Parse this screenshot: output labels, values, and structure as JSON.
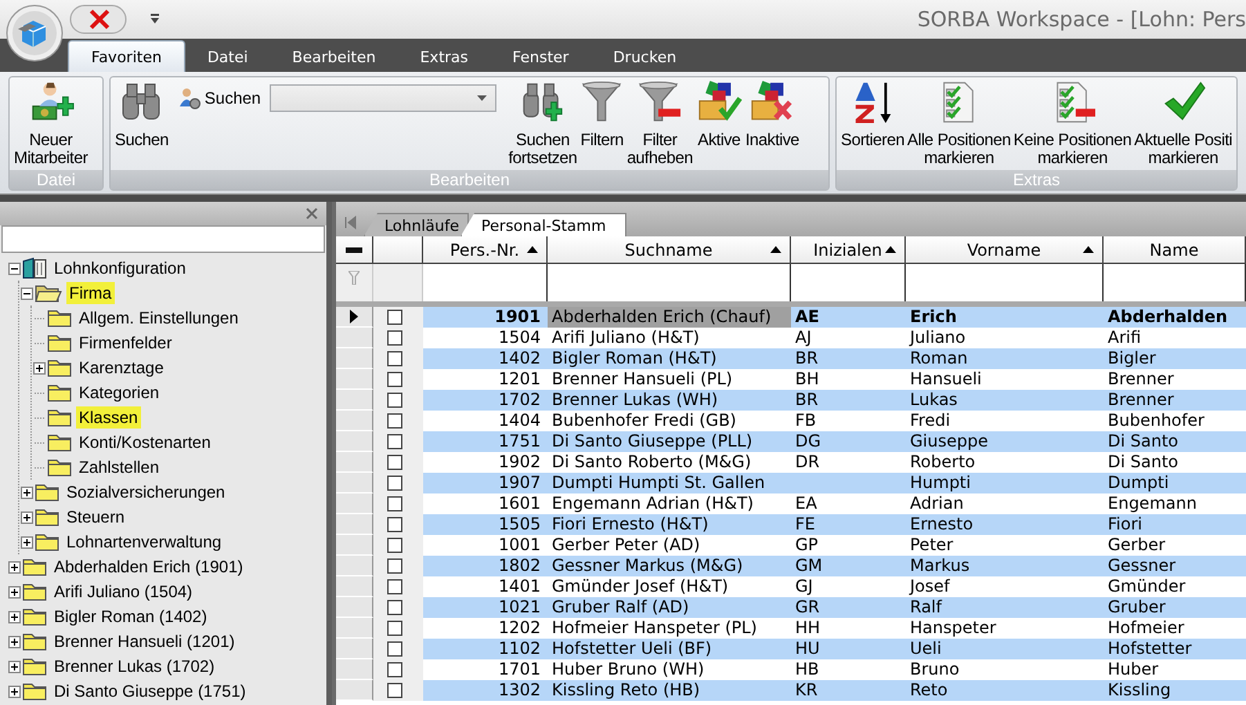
{
  "window": {
    "title": "SORBA Workspace - [Lohn: Pers"
  },
  "ribbon_tabs": [
    {
      "label": "Favoriten",
      "selected": true
    },
    {
      "label": "Datei",
      "selected": false
    },
    {
      "label": "Bearbeiten",
      "selected": false
    },
    {
      "label": "Extras",
      "selected": false
    },
    {
      "label": "Fenster",
      "selected": false
    },
    {
      "label": "Drucken",
      "selected": false
    }
  ],
  "ribbon_groups": [
    {
      "label": "Datei",
      "buttons": [
        {
          "label": "Neuer\nMitarbeiter"
        }
      ]
    },
    {
      "label": "Bearbeiten",
      "buttons": [
        {
          "label": "Suchen"
        },
        {
          "label": "Suchen\nfortsetzen"
        },
        {
          "label": "Filtern"
        },
        {
          "label": "Filter\naufheben"
        },
        {
          "label": "Aktive"
        },
        {
          "label": "Inaktive"
        }
      ],
      "search": {
        "label": "Suchen"
      }
    },
    {
      "label": "Extras",
      "buttons": [
        {
          "label": "Sortieren"
        },
        {
          "label": "Alle Positionen\nmarkieren"
        },
        {
          "label": "Keine Positionen\nmarkieren"
        },
        {
          "label": "Aktuelle Positi\nmarkieren"
        }
      ]
    }
  ],
  "tree": [
    {
      "label": "Lohnkonfiguration",
      "kind": "module",
      "expanded": true,
      "highlighted": false,
      "children": [
        {
          "label": "Firma",
          "kind": "folder",
          "expanded": true,
          "highlighted": true,
          "children": [
            {
              "label": "Allgem. Einstellungen",
              "kind": "folder",
              "highlighted": false
            },
            {
              "label": "Firmenfelder",
              "kind": "folder",
              "highlighted": false
            },
            {
              "label": "Karenztage",
              "kind": "folder",
              "expanded": false,
              "highlighted": false
            },
            {
              "label": "Kategorien",
              "kind": "folder",
              "highlighted": false
            },
            {
              "label": "Klassen",
              "kind": "folder",
              "highlighted": true
            },
            {
              "label": "Konti/Kostenarten",
              "kind": "folder",
              "highlighted": false
            },
            {
              "label": "Zahlstellen",
              "kind": "folder",
              "highlighted": false
            }
          ]
        },
        {
          "label": "Sozialversicherungen",
          "kind": "folder",
          "expanded": false,
          "highlighted": false
        },
        {
          "label": "Steuern",
          "kind": "folder",
          "expanded": false,
          "highlighted": false
        },
        {
          "label": "Lohnartenverwaltung",
          "kind": "folder",
          "expanded": false,
          "highlighted": false
        }
      ]
    },
    {
      "label": "Abderhalden Erich (1901)",
      "kind": "folder",
      "expanded": false,
      "highlighted": false
    },
    {
      "label": "Arifi Juliano (1504)",
      "kind": "folder",
      "expanded": false,
      "highlighted": false
    },
    {
      "label": "Bigler Roman (1402)",
      "kind": "folder",
      "expanded": false,
      "highlighted": false
    },
    {
      "label": "Brenner Hansueli (1201)",
      "kind": "folder",
      "expanded": false,
      "highlighted": false
    },
    {
      "label": "Brenner Lukas (1702)",
      "kind": "folder",
      "expanded": false,
      "highlighted": false
    },
    {
      "label": "Di Santo Giuseppe (1751)",
      "kind": "folder",
      "expanded": false,
      "highlighted": false
    }
  ],
  "doc_tabs": [
    {
      "label": "Lohnläufe",
      "selected": false
    },
    {
      "label": "Personal-Stamm",
      "selected": true
    }
  ],
  "table": {
    "columns": [
      {
        "label": "Pers.-Nr.",
        "sorted": true
      },
      {
        "label": "Suchname",
        "sorted": true
      },
      {
        "label": "Inizialen",
        "sorted": true
      },
      {
        "label": "Vorname",
        "sorted": true
      },
      {
        "label": "Name",
        "sorted": false
      }
    ],
    "rows": [
      {
        "pers_nr": "1901",
        "suchname": "Abderhalden Erich (Chauf)",
        "initials": "AE",
        "vorname": "Erich",
        "name": "Abderhalden",
        "checked": false,
        "current": true
      },
      {
        "pers_nr": "1504",
        "suchname": "Arifi Juliano (H&T)",
        "initials": "AJ",
        "vorname": "Juliano",
        "name": "Arifi",
        "checked": false,
        "current": false
      },
      {
        "pers_nr": "1402",
        "suchname": "Bigler Roman (H&T)",
        "initials": "BR",
        "vorname": "Roman",
        "name": "Bigler",
        "checked": false,
        "current": false
      },
      {
        "pers_nr": "1201",
        "suchname": "Brenner Hansueli (PL)",
        "initials": "BH",
        "vorname": "Hansueli",
        "name": "Brenner",
        "checked": false,
        "current": false
      },
      {
        "pers_nr": "1702",
        "suchname": "Brenner Lukas (WH)",
        "initials": "BR",
        "vorname": "Lukas",
        "name": "Brenner",
        "checked": false,
        "current": false
      },
      {
        "pers_nr": "1404",
        "suchname": "Bubenhofer Fredi (GB)",
        "initials": "FB",
        "vorname": "Fredi",
        "name": "Bubenhofer",
        "checked": false,
        "current": false
      },
      {
        "pers_nr": "1751",
        "suchname": "Di Santo Giuseppe (PLL)",
        "initials": "DG",
        "vorname": "Giuseppe",
        "name": "Di Santo",
        "checked": false,
        "current": false
      },
      {
        "pers_nr": "1902",
        "suchname": "Di Santo Roberto (M&G)",
        "initials": "DR",
        "vorname": "Roberto",
        "name": "Di Santo",
        "checked": false,
        "current": false
      },
      {
        "pers_nr": "1907",
        "suchname": "Dumpti Humpti St. Gallen",
        "vorname": "Humpti",
        "name": "Dumpti",
        "checked": false,
        "current": false
      },
      {
        "pers_nr": "1601",
        "suchname": "Engemann Adrian (H&T)",
        "initials": "EA",
        "vorname": "Adrian",
        "name": "Engemann",
        "checked": false,
        "current": false
      },
      {
        "pers_nr": "1505",
        "suchname": "Fiori Ernesto (H&T)",
        "initials": "FE",
        "vorname": "Ernesto",
        "name": "Fiori",
        "checked": false,
        "current": false
      },
      {
        "pers_nr": "1001",
        "suchname": "Gerber Peter (AD)",
        "initials": "GP",
        "vorname": "Peter",
        "name": "Gerber",
        "checked": false,
        "current": false
      },
      {
        "pers_nr": "1802",
        "suchname": "Gessner Markus (M&G)",
        "initials": "GM",
        "vorname": "Markus",
        "name": "Gessner",
        "checked": false,
        "current": false
      },
      {
        "pers_nr": "1401",
        "suchname": "Gmünder Josef (H&T)",
        "initials": "GJ",
        "vorname": "Josef",
        "name": "Gmünder",
        "checked": false,
        "current": false
      },
      {
        "pers_nr": "1021",
        "suchname": "Gruber Ralf (AD)",
        "initials": "GR",
        "vorname": "Ralf",
        "name": "Gruber",
        "checked": false,
        "current": false
      },
      {
        "pers_nr": "1202",
        "suchname": "Hofmeier Hanspeter (PL)",
        "initials": "HH",
        "vorname": "Hanspeter",
        "name": "Hofmeier",
        "checked": false,
        "current": false
      },
      {
        "pers_nr": "1102",
        "suchname": "Hofstetter Ueli (BF)",
        "initials": "HU",
        "vorname": "Ueli",
        "name": "Hofstetter",
        "checked": false,
        "current": false
      },
      {
        "pers_nr": "1701",
        "suchname": "Huber Bruno (WH)",
        "initials": "HB",
        "vorname": "Bruno",
        "name": "Huber",
        "checked": false,
        "current": false
      },
      {
        "pers_nr": "1302",
        "suchname": "Kissling Reto (HB)",
        "initials": "KR",
        "vorname": "Reto",
        "name": "Kissling",
        "checked": false,
        "current": false
      }
    ]
  }
}
